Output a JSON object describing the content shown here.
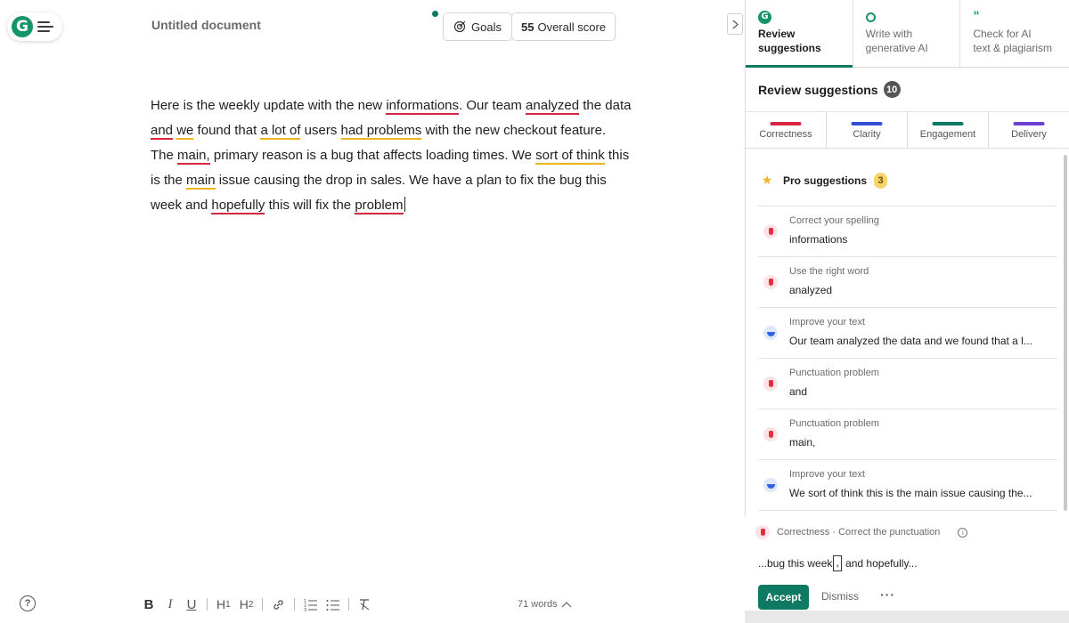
{
  "document": {
    "title": "Untitled document",
    "goals_label": "Goals",
    "score_value": "55",
    "score_label": "Overall score",
    "paragraph": [
      {
        "t": "Here is the weekly update with the new "
      },
      {
        "t": "informations",
        "u": "red"
      },
      {
        "t": ". Our team "
      },
      {
        "t": "analyzed",
        "u": "red"
      },
      {
        "t": " the data "
      },
      {
        "t": "and",
        "u": "red"
      },
      {
        "t": " "
      },
      {
        "t": "we",
        "u": "orange"
      },
      {
        "t": " found that "
      },
      {
        "t": "a lot of",
        "u": "orange"
      },
      {
        "t": " users "
      },
      {
        "t": "had problems",
        "u": "orange"
      },
      {
        "t": " with the new checkout feature. The "
      },
      {
        "t": "main,",
        "u": "red"
      },
      {
        "t": " primary reason is a bug that affects loading times. We "
      },
      {
        "t": "sort of think",
        "u": "orange"
      },
      {
        "t": " this is the "
      },
      {
        "t": "main",
        "u": "orange"
      },
      {
        "t": " issue causing the drop in sales. We have a plan to fix the bug this week and "
      },
      {
        "t": "hopefully",
        "u": "red"
      },
      {
        "t": " this will fix the "
      },
      {
        "t": "problem",
        "u": "red"
      }
    ],
    "word_count": "71 words",
    "help_label": "?"
  },
  "toolbar": {
    "bold": "B",
    "italic": "I",
    "underline": "U",
    "h1": "H",
    "h1_sub": "1",
    "h2": "H",
    "h2_sub": "2"
  },
  "panel": {
    "tabs": [
      {
        "line1": "Review",
        "line2": "suggestions",
        "icon": "grammarly-g-icon"
      },
      {
        "line1": "Write with",
        "line2": "generative AI",
        "icon": "bulb-icon"
      },
      {
        "line1": "Check for AI",
        "line2": "text & plagiarism",
        "icon": "quote-icon"
      }
    ],
    "review_title": "Review suggestions",
    "review_count": "10",
    "categories": [
      {
        "label": "Correctness",
        "color": "#d7263d"
      },
      {
        "label": "Clarity",
        "color": "#2f4fd6"
      },
      {
        "label": "Engagement",
        "color": "#0f7a63"
      },
      {
        "label": "Delivery",
        "color": "#6a3fd1"
      }
    ],
    "pro_label": "Pro suggestions",
    "pro_count": "3",
    "suggestions": [
      {
        "type": "Correct your spelling",
        "text": "informations",
        "kind": "red"
      },
      {
        "type": "Use the right word",
        "text": "analyzed",
        "kind": "red"
      },
      {
        "type": "Improve your text",
        "text": "Our team analyzed the data and we found that a l...",
        "kind": "blue"
      },
      {
        "type": "Punctuation problem",
        "text": "and",
        "kind": "red"
      },
      {
        "type": "Punctuation problem",
        "text": "main,",
        "kind": "red"
      },
      {
        "type": "Improve your text",
        "text": "We sort of think this is the main issue causing the...",
        "kind": "blue"
      }
    ],
    "active": {
      "category": "Correctness · Correct the punctuation",
      "preview_before": "...bug this week",
      "preview_insert": ",",
      "preview_after": " and hopefully...",
      "accept_label": "Accept",
      "dismiss_label": "Dismiss",
      "more_label": "···"
    }
  },
  "colors": {
    "brand_green": "#15946b",
    "accept_green": "#0f7a63",
    "error_red": "#d7263d",
    "style_orange": "#f1b31c"
  }
}
